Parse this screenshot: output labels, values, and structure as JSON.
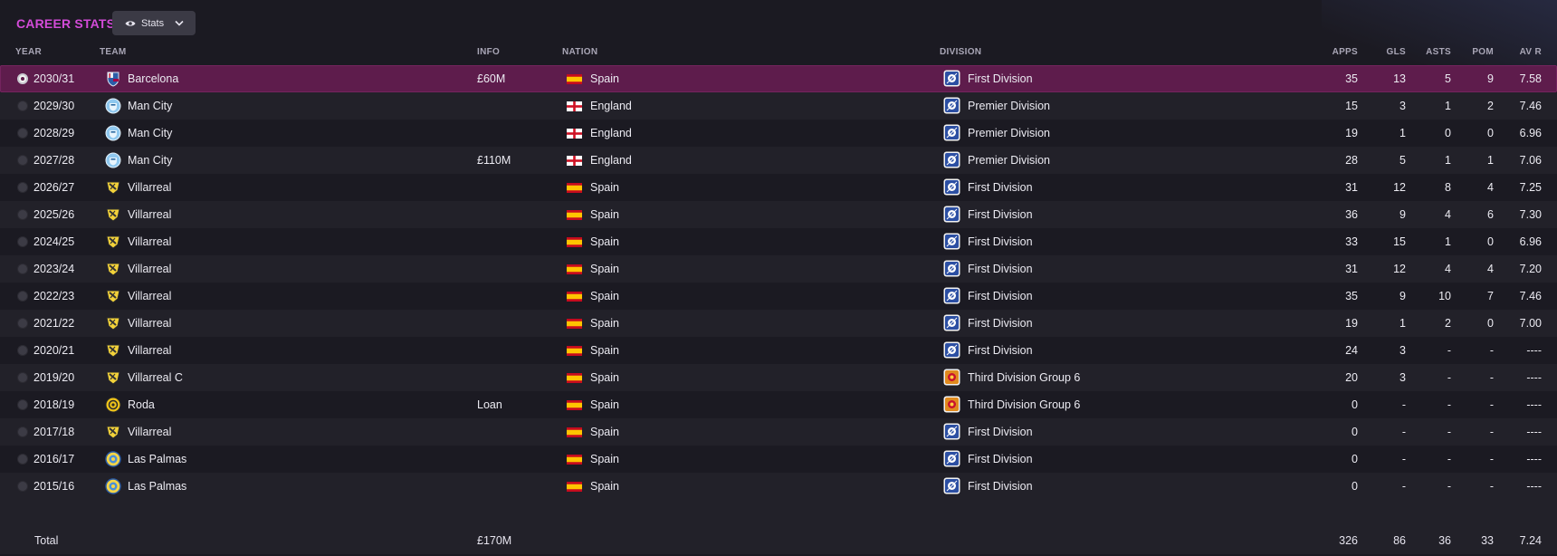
{
  "panel": {
    "title": "CAREER STATS",
    "view_button_label": "Stats"
  },
  "columns": {
    "year": "YEAR",
    "team": "TEAM",
    "info": "INFO",
    "nation": "NATION",
    "division": "DIVISION",
    "apps": "APPS",
    "gls": "GLS",
    "asts": "ASTS",
    "pom": "POM",
    "avr": "AV R"
  },
  "colors": {
    "accent": "#d34bd8",
    "selected_row": "#5e1c4c"
  },
  "rows": [
    {
      "year": "2030/31",
      "team": "Barcelona",
      "crest": "barcelona-crest-icon",
      "info": "£60M",
      "nation": "Spain",
      "flag": "spain-flag-icon",
      "division": "First Division",
      "division_logo": "first-division-logo-icon",
      "apps": "35",
      "gls": "13",
      "asts": "5",
      "pom": "9",
      "avr": "7.58",
      "selected": true
    },
    {
      "year": "2029/30",
      "team": "Man City",
      "crest": "man-city-crest-icon",
      "info": "",
      "nation": "England",
      "flag": "england-flag-icon",
      "division": "Premier Division",
      "division_logo": "premier-division-logo-icon",
      "apps": "15",
      "gls": "3",
      "asts": "1",
      "pom": "2",
      "avr": "7.46"
    },
    {
      "year": "2028/29",
      "team": "Man City",
      "crest": "man-city-crest-icon",
      "info": "",
      "nation": "England",
      "flag": "england-flag-icon",
      "division": "Premier Division",
      "division_logo": "premier-division-logo-icon",
      "apps": "19",
      "gls": "1",
      "asts": "0",
      "pom": "0",
      "avr": "6.96"
    },
    {
      "year": "2027/28",
      "team": "Man City",
      "crest": "man-city-crest-icon",
      "info": "£110M",
      "nation": "England",
      "flag": "england-flag-icon",
      "division": "Premier Division",
      "division_logo": "premier-division-logo-icon",
      "apps": "28",
      "gls": "5",
      "asts": "1",
      "pom": "1",
      "avr": "7.06"
    },
    {
      "year": "2026/27",
      "team": "Villarreal",
      "crest": "villarreal-crest-icon",
      "info": "",
      "nation": "Spain",
      "flag": "spain-flag-icon",
      "division": "First Division",
      "division_logo": "first-division-logo-icon",
      "apps": "31",
      "gls": "12",
      "asts": "8",
      "pom": "4",
      "avr": "7.25"
    },
    {
      "year": "2025/26",
      "team": "Villarreal",
      "crest": "villarreal-crest-icon",
      "info": "",
      "nation": "Spain",
      "flag": "spain-flag-icon",
      "division": "First Division",
      "division_logo": "first-division-logo-icon",
      "apps": "36",
      "gls": "9",
      "asts": "4",
      "pom": "6",
      "avr": "7.30"
    },
    {
      "year": "2024/25",
      "team": "Villarreal",
      "crest": "villarreal-crest-icon",
      "info": "",
      "nation": "Spain",
      "flag": "spain-flag-icon",
      "division": "First Division",
      "division_logo": "first-division-logo-icon",
      "apps": "33",
      "gls": "15",
      "asts": "1",
      "pom": "0",
      "avr": "6.96"
    },
    {
      "year": "2023/24",
      "team": "Villarreal",
      "crest": "villarreal-crest-icon",
      "info": "",
      "nation": "Spain",
      "flag": "spain-flag-icon",
      "division": "First Division",
      "division_logo": "first-division-logo-icon",
      "apps": "31",
      "gls": "12",
      "asts": "4",
      "pom": "4",
      "avr": "7.20"
    },
    {
      "year": "2022/23",
      "team": "Villarreal",
      "crest": "villarreal-crest-icon",
      "info": "",
      "nation": "Spain",
      "flag": "spain-flag-icon",
      "division": "First Division",
      "division_logo": "first-division-logo-icon",
      "apps": "35",
      "gls": "9",
      "asts": "10",
      "pom": "7",
      "avr": "7.46"
    },
    {
      "year": "2021/22",
      "team": "Villarreal",
      "crest": "villarreal-crest-icon",
      "info": "",
      "nation": "Spain",
      "flag": "spain-flag-icon",
      "division": "First Division",
      "division_logo": "first-division-logo-icon",
      "apps": "19",
      "gls": "1",
      "asts": "2",
      "pom": "0",
      "avr": "7.00"
    },
    {
      "year": "2020/21",
      "team": "Villarreal",
      "crest": "villarreal-crest-icon",
      "info": "",
      "nation": "Spain",
      "flag": "spain-flag-icon",
      "division": "First Division",
      "division_logo": "first-division-logo-icon",
      "apps": "24",
      "gls": "3",
      "asts": "-",
      "pom": "-",
      "avr": "----"
    },
    {
      "year": "2019/20",
      "team": "Villarreal C",
      "crest": "villarreal-crest-icon",
      "info": "",
      "nation": "Spain",
      "flag": "spain-flag-icon",
      "division": "Third Division Group 6",
      "division_logo": "third-division-logo-icon",
      "apps": "20",
      "gls": "3",
      "asts": "-",
      "pom": "-",
      "avr": "----"
    },
    {
      "year": "2018/19",
      "team": "Roda",
      "crest": "roda-crest-icon",
      "info": "Loan",
      "nation": "Spain",
      "flag": "spain-flag-icon",
      "division": "Third Division Group 6",
      "division_logo": "third-division-logo-icon",
      "apps": "0",
      "gls": "-",
      "asts": "-",
      "pom": "-",
      "avr": "----"
    },
    {
      "year": "2017/18",
      "team": "Villarreal",
      "crest": "villarreal-crest-icon",
      "info": "",
      "nation": "Spain",
      "flag": "spain-flag-icon",
      "division": "First Division",
      "division_logo": "first-division-logo-icon",
      "apps": "0",
      "gls": "-",
      "asts": "-",
      "pom": "-",
      "avr": "----"
    },
    {
      "year": "2016/17",
      "team": "Las Palmas",
      "crest": "las-palmas-crest-icon",
      "info": "",
      "nation": "Spain",
      "flag": "spain-flag-icon",
      "division": "First Division",
      "division_logo": "first-division-logo-icon",
      "apps": "0",
      "gls": "-",
      "asts": "-",
      "pom": "-",
      "avr": "----"
    },
    {
      "year": "2015/16",
      "team": "Las Palmas",
      "crest": "las-palmas-crest-icon",
      "info": "",
      "nation": "Spain",
      "flag": "spain-flag-icon",
      "division": "First Division",
      "division_logo": "first-division-logo-icon",
      "apps": "0",
      "gls": "-",
      "asts": "-",
      "pom": "-",
      "avr": "----"
    }
  ],
  "total": {
    "label": "Total",
    "info": "£170M",
    "apps": "326",
    "gls": "86",
    "asts": "36",
    "pom": "33",
    "avr": "7.24"
  }
}
